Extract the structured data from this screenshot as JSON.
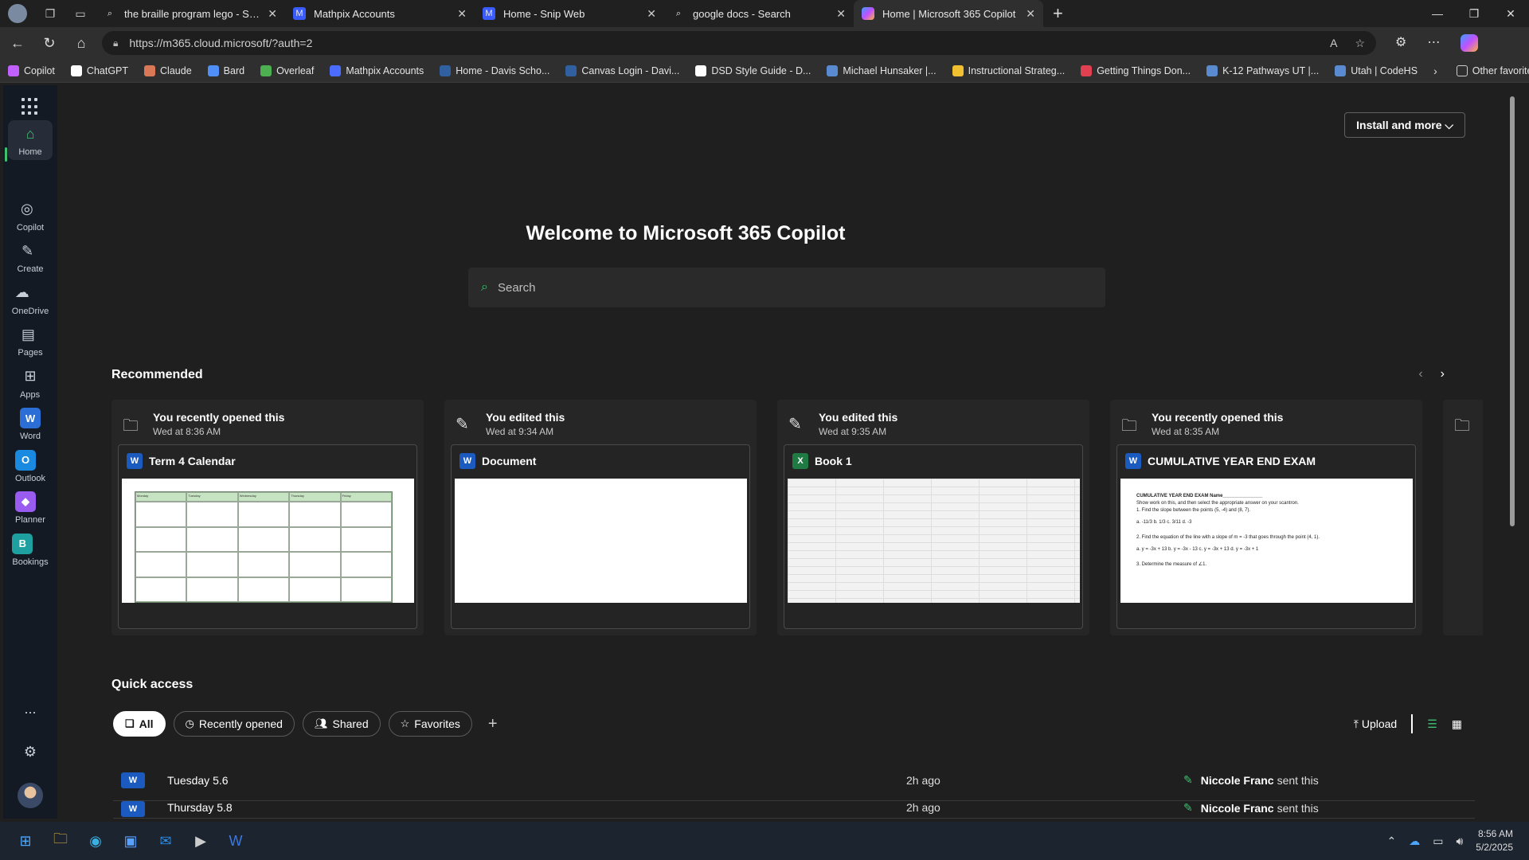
{
  "browser": {
    "tabs": [
      {
        "title": "the braille program lego - Search",
        "icon": "search-icon"
      },
      {
        "title": "Mathpix Accounts",
        "icon": "mathpix-icon"
      },
      {
        "title": "Home - Snip Web",
        "icon": "mathpix-icon"
      },
      {
        "title": "google docs - Search",
        "icon": "search-icon"
      },
      {
        "title": "Home | Microsoft 365 Copilot",
        "icon": "copilot-icon",
        "active": true
      }
    ],
    "url": "https://m365.cloud.microsoft/?auth=2",
    "bookmarks": [
      {
        "label": "Copilot",
        "color": "#c060ff"
      },
      {
        "label": "ChatGPT",
        "color": "#ffffff"
      },
      {
        "label": "Claude",
        "color": "#d97757"
      },
      {
        "label": "Bard",
        "color": "#4f8ff7"
      },
      {
        "label": "Overleaf",
        "color": "#4caf50"
      },
      {
        "label": "Mathpix Accounts",
        "color": "#4a6cff"
      },
      {
        "label": "Home - Davis Scho...",
        "color": "#3060a0"
      },
      {
        "label": "Canvas Login - Davi...",
        "color": "#3060a0"
      },
      {
        "label": "DSD Style Guide - D...",
        "color": "#ffffff"
      },
      {
        "label": "Michael Hunsaker |...",
        "color": "#5a8ad0"
      },
      {
        "label": "Instructional Strateg...",
        "color": "#f0c030"
      },
      {
        "label": "Getting Things Don...",
        "color": "#e04050"
      },
      {
        "label": "K-12 Pathways UT |...",
        "color": "#5a8ad0"
      },
      {
        "label": "Utah | CodeHS",
        "color": "#5a8ad0"
      }
    ],
    "other_favorites": "Other favorites"
  },
  "rail": {
    "items": [
      {
        "label": "Home",
        "icon": "home-icon"
      },
      {
        "label": "Copilot",
        "icon": "copilot-icon"
      },
      {
        "label": "Create",
        "icon": "pen-icon"
      },
      {
        "label": "OneDrive",
        "icon": "cloud-icon"
      },
      {
        "label": "Pages",
        "icon": "pages-icon"
      },
      {
        "label": "Apps",
        "icon": "apps-icon"
      },
      {
        "label": "Word",
        "icon": "word-icon"
      },
      {
        "label": "Outlook",
        "icon": "outlook-icon"
      },
      {
        "label": "Planner",
        "icon": "planner-icon"
      },
      {
        "label": "Bookings",
        "icon": "bookings-icon"
      }
    ],
    "more": "...",
    "accent": "#3ec070"
  },
  "main": {
    "install_button": "Install and more",
    "welcome": "Welcome to Microsoft 365 Copilot",
    "search_placeholder": "Search",
    "recommended_title": "Recommended",
    "cards": [
      {
        "activity": "You recently opened this",
        "time": "Wed at 8:36 AM",
        "file": "Term 4 Calendar",
        "app": "W"
      },
      {
        "activity": "You edited this",
        "time": "Wed at 9:34 AM",
        "file": "Document",
        "app": "W"
      },
      {
        "activity": "You edited this",
        "time": "Wed at 9:35 AM",
        "file": "Book 1",
        "app": "X"
      },
      {
        "activity": "You recently opened this",
        "time": "Wed at 8:35 AM",
        "file": "CUMULATIVE YEAR END EXAM",
        "app": "W"
      }
    ],
    "calendar_preview": {
      "headers": [
        "Monday",
        "Tuesday",
        "Wednesday",
        "Thursday",
        "Friday"
      ]
    },
    "exam_preview": {
      "lines": [
        "CUMULATIVE YEAR END EXAM                    Name_______________",
        "Show work on this, and then select the appropriate answer on your scantron.",
        "1.  Find the slope between the points (5, -4) and (8, 7).",
        "a. -11/3          b. 1/3          c. 3/11          d. -3",
        "2.  Find the equation of the line with a slope of m = -3 that goes through the point (4, 1).",
        "a. y = -3x + 13       b. y = -3x - 13       c. y = -3x + 13       d. y = -3x + 1",
        "3.  Determine the measure of ∠1."
      ]
    },
    "quick_access_title": "Quick access",
    "filters": [
      {
        "label": "All",
        "icon": "files-icon",
        "active": true
      },
      {
        "label": "Recently opened",
        "icon": "clock-icon"
      },
      {
        "label": "Shared",
        "icon": "people-icon"
      },
      {
        "label": "Favorites",
        "icon": "star-icon"
      }
    ],
    "upload_label": "Upload",
    "files": [
      {
        "name": "Tuesday 5.6",
        "time": "2h ago",
        "who": "Niccole Franc",
        "action": "sent this"
      },
      {
        "name": "Thursday 5.8",
        "time": "2h ago",
        "who": "Niccole Franc",
        "action": "sent this"
      }
    ]
  },
  "taskbar": {
    "time": "8:56 AM",
    "date": "5/2/2025"
  }
}
